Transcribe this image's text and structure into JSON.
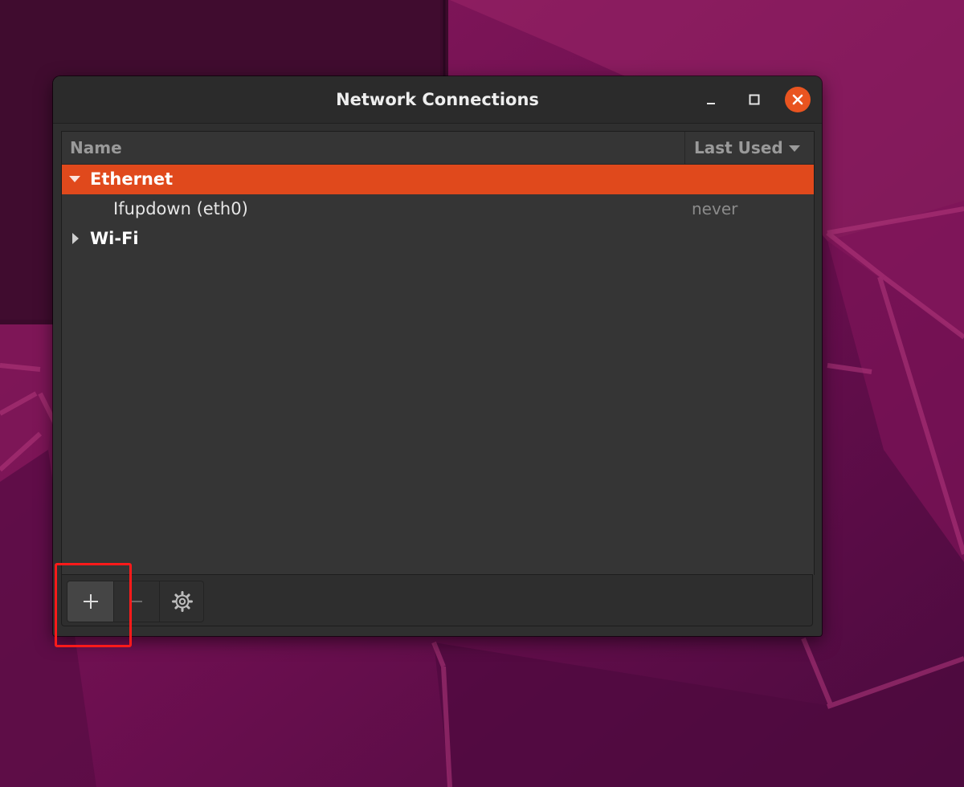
{
  "window": {
    "title": "Network Connections",
    "controls": {
      "minimize_icon": "minimize-icon",
      "maximize_icon": "maximize-icon",
      "close_icon": "close-icon"
    }
  },
  "list": {
    "columns": {
      "name": "Name",
      "last_used": "Last Used"
    },
    "sort_icon": "sort-descending-arrow-icon",
    "groups": [
      {
        "label": "Ethernet",
        "expanded": true,
        "selected": true,
        "expander_icon": "expander-down-triangle-icon",
        "items": [
          {
            "name": "Ifupdown (eth0)",
            "last_used": "never"
          }
        ]
      },
      {
        "label": "Wi-Fi",
        "expanded": false,
        "selected": false,
        "expander_icon": "expander-right-triangle-icon",
        "items": []
      }
    ]
  },
  "toolbar": {
    "buttons": [
      {
        "id": "add",
        "icon": "plus-icon"
      },
      {
        "id": "remove",
        "icon": "minus-icon"
      },
      {
        "id": "settings",
        "icon": "gear-icon"
      }
    ],
    "highlighted_button": "add"
  },
  "colors": {
    "accent": "#e0491c",
    "close_button": "#e95420",
    "highlight_box": "#ff1a1a",
    "window_bg": "#2f2f2f",
    "list_bg": "#353535"
  }
}
